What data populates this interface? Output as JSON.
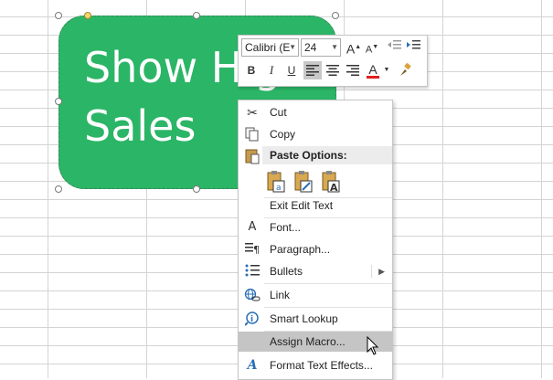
{
  "shape": {
    "text": "Show Hig\nSales"
  },
  "mini_toolbar": {
    "font_name": "Calibri (E",
    "font_size": "24",
    "grow_font": "A",
    "shrink_font": "A",
    "bold": "B",
    "italic": "I",
    "underline": "U",
    "font_color_glyph": "A",
    "font_color": "#e02020"
  },
  "menu": {
    "cut": "Cut",
    "copy": "Copy",
    "paste_options": "Paste Options:",
    "exit_edit_text": "Exit Edit Text",
    "font": "Font...",
    "paragraph": "Paragraph...",
    "bullets": "Bullets",
    "link": "Link",
    "smart_lookup": "Smart Lookup",
    "assign_macro": "Assign Macro...",
    "format_text_effects": "Format Text Effects..."
  },
  "colors": {
    "shape_fill": "#2bb566",
    "menu_hover": "#c5c5c5"
  }
}
